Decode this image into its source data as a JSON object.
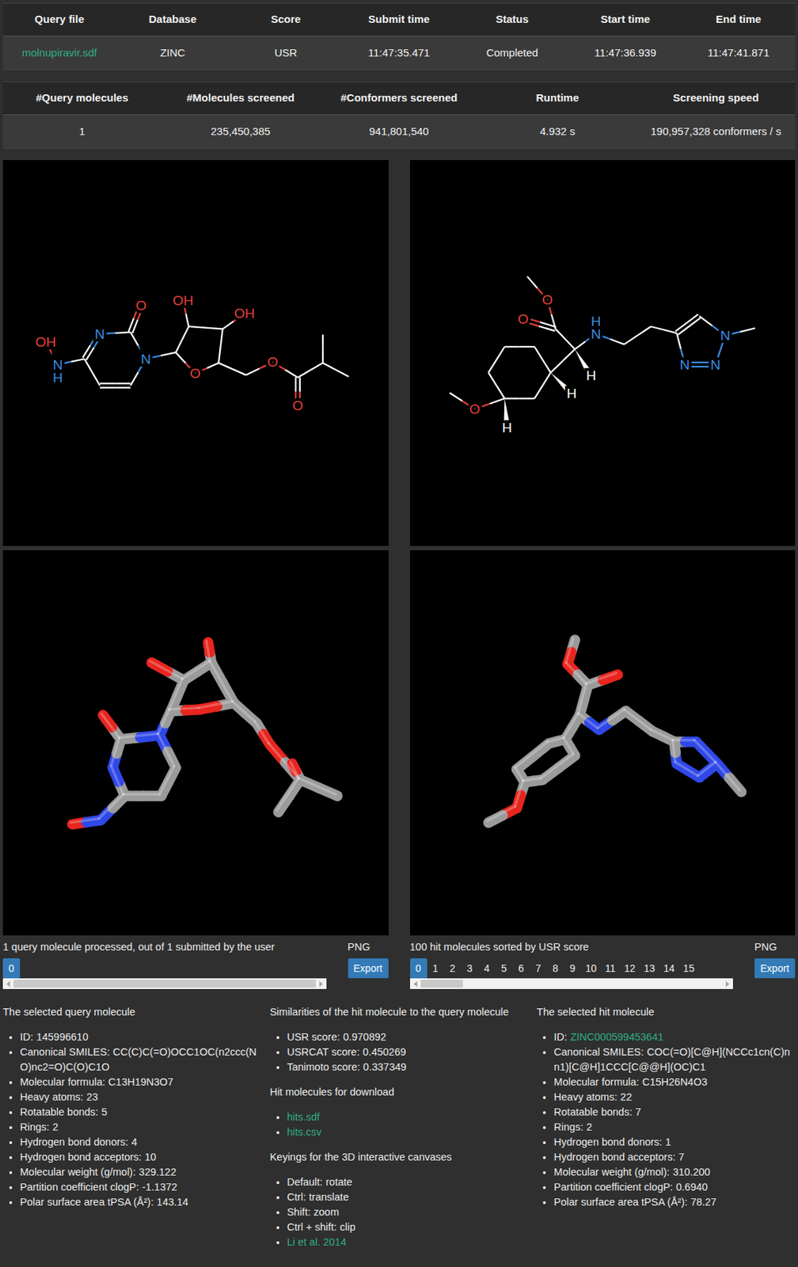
{
  "job_table": {
    "columns": [
      "Query file",
      "Database",
      "Score",
      "Submit time",
      "Status",
      "Start time",
      "End time"
    ],
    "row": [
      {
        "text": "molnupiravir.sdf",
        "link": true
      },
      {
        "text": "ZINC",
        "link": false
      },
      {
        "text": "USR",
        "link": false
      },
      {
        "text": "11:47:35.471",
        "link": false
      },
      {
        "text": "Completed",
        "link": false
      },
      {
        "text": "11:47:36.939",
        "link": false
      },
      {
        "text": "11:47:41.871",
        "link": false
      }
    ]
  },
  "stats_table": {
    "columns": [
      "#Query molecules",
      "#Molecules screened",
      "#Conformers screened",
      "Runtime",
      "Screening speed"
    ],
    "row": [
      "1",
      "235,450,385",
      "941,801,540",
      "4.932 s",
      "190,957,328 conformers / s"
    ]
  },
  "query_2d": {
    "labels": [
      {
        "text": "OH",
        "color": "#e8403b"
      },
      {
        "text": "N",
        "color": "#3b8ee8"
      },
      {
        "text": "H",
        "color": "#3b8ee8"
      },
      {
        "text": "N",
        "color": "#3b8ee8"
      },
      {
        "text": "O",
        "color": "#e8403b"
      },
      {
        "text": "N",
        "color": "#3b8ee8"
      },
      {
        "text": "OH",
        "color": "#e8403b"
      },
      {
        "text": "OH",
        "color": "#e8403b"
      },
      {
        "text": "O",
        "color": "#e8403b"
      },
      {
        "text": "O",
        "color": "#e8403b"
      },
      {
        "text": "O",
        "color": "#e8403b"
      }
    ]
  },
  "hit_2d": {
    "labels": [
      {
        "text": "O",
        "color": "#e8403b"
      },
      {
        "text": "O",
        "color": "#e8403b"
      },
      {
        "text": "N",
        "color": "#3b8ee8"
      },
      {
        "text": "H",
        "color": "#3b8ee8"
      },
      {
        "text": "H",
        "color": "#ffffff"
      },
      {
        "text": "N",
        "color": "#3b8ee8"
      },
      {
        "text": "N",
        "color": "#3b8ee8"
      },
      {
        "text": "N",
        "color": "#3b8ee8"
      },
      {
        "text": "H",
        "color": "#ffffff"
      },
      {
        "text": "O",
        "color": "#e8403b"
      },
      {
        "text": "H",
        "color": "#ffffff"
      }
    ]
  },
  "query_panel": {
    "caption": "1 query molecule processed, out of 1 submitted by the user",
    "format": "PNG",
    "export": "Export",
    "pages": [
      {
        "label": "0",
        "selected": true
      }
    ],
    "scroll_level": 1.0
  },
  "hit_panel": {
    "caption": "100 hit molecules sorted by USR score",
    "format": "PNG",
    "export": "Export",
    "pages": [
      {
        "label": "0",
        "selected": true
      },
      {
        "label": "1",
        "selected": false
      },
      {
        "label": "2",
        "selected": false
      },
      {
        "label": "3",
        "selected": false
      },
      {
        "label": "4",
        "selected": false
      },
      {
        "label": "5",
        "selected": false
      },
      {
        "label": "6",
        "selected": false
      },
      {
        "label": "7",
        "selected": false
      },
      {
        "label": "8",
        "selected": false
      },
      {
        "label": "9",
        "selected": false
      },
      {
        "label": "10",
        "selected": false
      },
      {
        "label": "11",
        "selected": false
      },
      {
        "label": "12",
        "selected": false
      },
      {
        "label": "13",
        "selected": false
      },
      {
        "label": "14",
        "selected": false
      },
      {
        "label": "15",
        "selected": false
      }
    ],
    "scroll_level": 0.14
  },
  "query_info": {
    "heading": "The selected query molecule",
    "items": [
      {
        "kind": "pair",
        "label": "ID:",
        "value": "145996610"
      },
      {
        "kind": "pair",
        "label": "Canonical SMILES:",
        "value": "CC(C)C(=O)OCC1OC(n2ccc(NO)nc2=O)C(O)C1O"
      },
      {
        "kind": "pair",
        "label": "Molecular formula:",
        "value": "C13H19N3O7"
      },
      {
        "kind": "pair",
        "label": "Heavy atoms:",
        "value": "23"
      },
      {
        "kind": "pair",
        "label": "Rotatable bonds:",
        "value": "5"
      },
      {
        "kind": "pair",
        "label": "Rings:",
        "value": "2"
      },
      {
        "kind": "pair",
        "label": "Hydrogen bond donors:",
        "value": "4"
      },
      {
        "kind": "pair",
        "label": "Hydrogen bond acceptors:",
        "value": "10"
      },
      {
        "kind": "pair",
        "label": "Molecular weight (g/mol):",
        "value": "329.122"
      },
      {
        "kind": "pair",
        "label": "Partition coefficient clogP:",
        "value": "-1.1372"
      },
      {
        "kind": "pair",
        "label": "Polar surface area tPSA (Å²):",
        "value": "143.14"
      }
    ]
  },
  "similarities": {
    "heading": "Similarities of the hit molecule to the query molecule",
    "items": [
      {
        "kind": "pair",
        "label": "USR score:",
        "value": "0.970892"
      },
      {
        "kind": "pair",
        "label": "USRCAT score:",
        "value": "0.450269"
      },
      {
        "kind": "pair",
        "label": "Tanimoto score:",
        "value": "0.337349"
      }
    ]
  },
  "downloads": {
    "heading": "Hit molecules for download",
    "items": [
      {
        "kind": "link",
        "value": "hits.sdf"
      },
      {
        "kind": "link",
        "value": "hits.csv"
      }
    ]
  },
  "keyings": {
    "heading": "Keyings for the 3D interactive canvases",
    "items": [
      {
        "kind": "pair",
        "label": "Default:",
        "value": "rotate"
      },
      {
        "kind": "pair",
        "label": "Ctrl:",
        "value": "translate"
      },
      {
        "kind": "pair",
        "label": "Shift:",
        "value": "zoom"
      },
      {
        "kind": "pair",
        "label": "Ctrl + shift:",
        "value": "clip"
      },
      {
        "kind": "link",
        "value": "Li et al. 2014"
      }
    ]
  },
  "hit_info": {
    "heading": "The selected hit molecule",
    "items": [
      {
        "kind": "pair-link",
        "label": "ID:",
        "value": "ZINC000599453641"
      },
      {
        "kind": "pair",
        "label": "Canonical SMILES:",
        "value": "COC(=O)[C@H](NCCc1cn(C)nn1)[C@H]1CCC[C@@H](OC)C1"
      },
      {
        "kind": "pair",
        "label": "Molecular formula:",
        "value": "C15H26N4O3"
      },
      {
        "kind": "pair",
        "label": "Heavy atoms:",
        "value": "22"
      },
      {
        "kind": "pair",
        "label": "Rotatable bonds:",
        "value": "7"
      },
      {
        "kind": "pair",
        "label": "Rings:",
        "value": "2"
      },
      {
        "kind": "pair",
        "label": "Hydrogen bond donors:",
        "value": "1"
      },
      {
        "kind": "pair",
        "label": "Hydrogen bond acceptors:",
        "value": "7"
      },
      {
        "kind": "pair",
        "label": "Molecular weight (g/mol):",
        "value": "310.200"
      },
      {
        "kind": "pair",
        "label": "Partition coefficient clogP:",
        "value": "0.6940"
      },
      {
        "kind": "pair",
        "label": "Polar surface area tPSA (Å²):",
        "value": "78.27"
      }
    ]
  }
}
